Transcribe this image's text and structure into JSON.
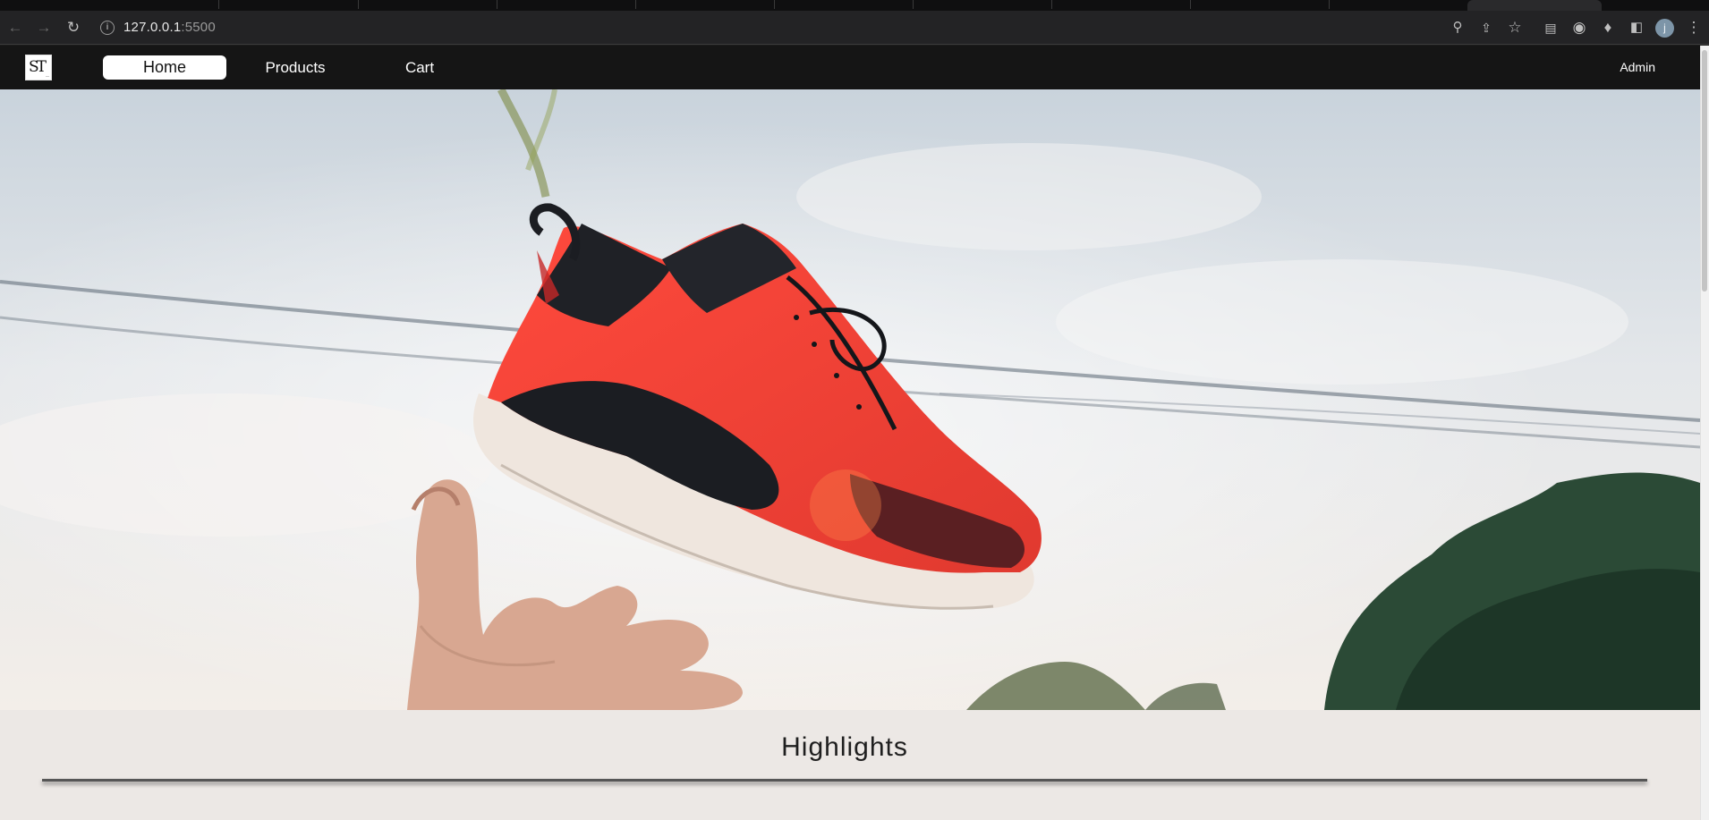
{
  "browser": {
    "url_host": "127.0.0.1",
    "url_port": ":5500",
    "profile_initial": "j",
    "icons": [
      "back-arrow-icon",
      "forward-arrow-icon",
      "reload-icon",
      "info-icon",
      "zoom-icon",
      "share-icon",
      "star-icon",
      "extension-icon",
      "puzzle-icon",
      "sidepanel-icon",
      "menu-dots-icon"
    ]
  },
  "navbar": {
    "logo_text": "ST",
    "links": [
      {
        "label": "Home",
        "active": true
      },
      {
        "label": "Products",
        "active": false
      },
      {
        "label": "Cart",
        "active": false
      }
    ],
    "admin_label": "Admin"
  },
  "hero": {
    "image": "sneaker-tossed-to-hand",
    "colors": {
      "sky": "#dfe4e8",
      "shoe_red": "#f2453a",
      "shoe_dark": "#1b1d22",
      "sole": "#ede4dc",
      "foliage": "#22402f"
    }
  },
  "highlights": {
    "title": "Highlights"
  }
}
